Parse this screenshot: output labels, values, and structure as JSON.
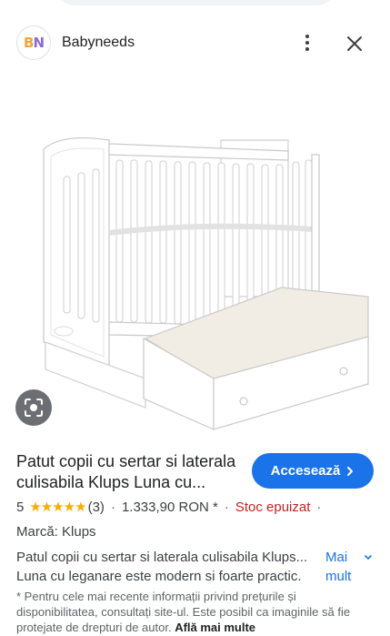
{
  "header": {
    "logo_text_b": "B",
    "logo_text_n": "N",
    "site_name": "Babyneeds"
  },
  "product": {
    "title": "Patut copii cu sertar si laterala culisabila Klups Luna cu...",
    "visit_label": "Accesează",
    "rating_value": "5",
    "stars": "★★★★★",
    "review_count": "(3)",
    "price": "1.333,90 RON *",
    "stock": "Stoc epuizat",
    "brand": "Marcă: Klups",
    "description_line1": "Patul copii cu sertar si laterala culisabila Klups...",
    "description_line2": "Luna cu leganare este modern si foarte practic.",
    "more_label_1": "Mai",
    "more_label_2": "mult",
    "disclaimer": "* Pentru cele mai recente informații privind prețurile și disponibilitatea, consultați site-ul. Este posibil ca imaginile să fie protejate de drepturi de autor.",
    "learn_more": "Află mai multe"
  },
  "colors": {
    "accent": "#1a73e8",
    "stars": "#f9ab00",
    "stock": "#c5221f"
  },
  "icons": {
    "more": "more-vert-icon",
    "close": "close-icon",
    "lens": "lens-search-icon",
    "visit": "chevron-right-icon"
  }
}
